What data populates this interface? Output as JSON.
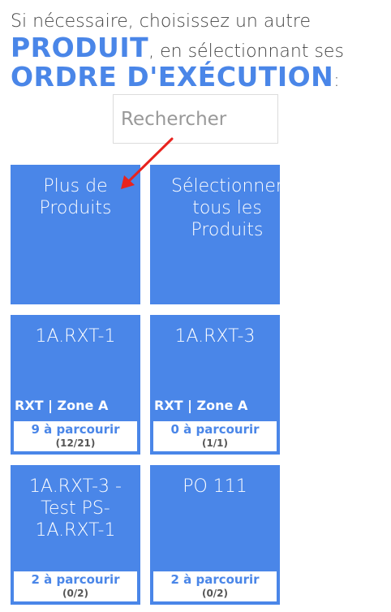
{
  "header": {
    "intro_text": "Si nécessaire, choisissez un autre",
    "product_word": "PRODUIT",
    "middle_text": ", en sélectionnant ses",
    "order_word": "ORDRE D'EXÉCUTION",
    "colon": ":"
  },
  "search": {
    "placeholder": "Rechercher"
  },
  "actions": {
    "more_products": "Plus de Produits",
    "select_all": "Sélectionner tous les Produits"
  },
  "products": [
    {
      "name": "1A.RXT-1",
      "zone": "RXT | Zone A",
      "todo": "9 à parcourir",
      "ratio": "(12/21)"
    },
    {
      "name": "1A.RXT-3",
      "zone": "RXT | Zone A",
      "todo": "0 à parcourir",
      "ratio": "(1/1)"
    },
    {
      "name": "1A.RXT-3 - Test PS-1A.RXT-1",
      "zone": "",
      "todo": "2 à parcourir",
      "ratio": "(0/2)"
    },
    {
      "name": "PO 111",
      "zone": "",
      "todo": "2 à parcourir",
      "ratio": "(0/2)"
    }
  ],
  "colors": {
    "accent": "#4a86e8",
    "annotation_arrow": "#e8231e",
    "text": "#444444"
  }
}
